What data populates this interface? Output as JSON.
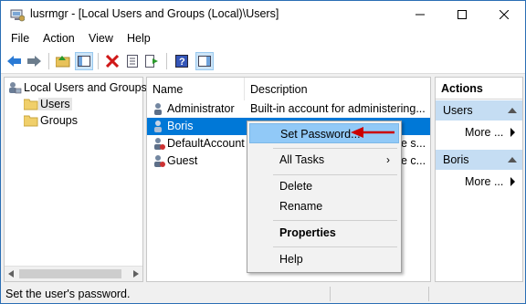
{
  "window": {
    "title": "lusrmgr - [Local Users and Groups (Local)\\Users]"
  },
  "menu": [
    "File",
    "Action",
    "View",
    "Help"
  ],
  "tree": {
    "root": "Local Users and Groups",
    "children": [
      "Users",
      "Groups"
    ],
    "selected": "Users"
  },
  "list": {
    "columns": [
      "Name",
      "Description"
    ],
    "rows": [
      {
        "name": "Administrator",
        "description": "Built-in account for administering..."
      },
      {
        "name": "Boris",
        "description": ""
      },
      {
        "name": "DefaultAccount",
        "description": "e s..."
      },
      {
        "name": "Guest",
        "description": "e c..."
      }
    ],
    "selected_index": 1
  },
  "actions": {
    "title": "Actions",
    "sections": [
      {
        "label": "Users",
        "item": "More ..."
      },
      {
        "label": "Boris",
        "item": "More ..."
      }
    ]
  },
  "context_menu": {
    "items": [
      "Set Password...",
      "All Tasks",
      "Delete",
      "Rename",
      "Properties",
      "Help"
    ],
    "highlighted": "Set Password...",
    "accent": "#cc0000"
  },
  "status": {
    "text": "Set the user's password."
  },
  "colors": {
    "selection": "#0078d7",
    "actions_section": "#c5ddf3",
    "menu_highlight": "#91c9f7"
  }
}
